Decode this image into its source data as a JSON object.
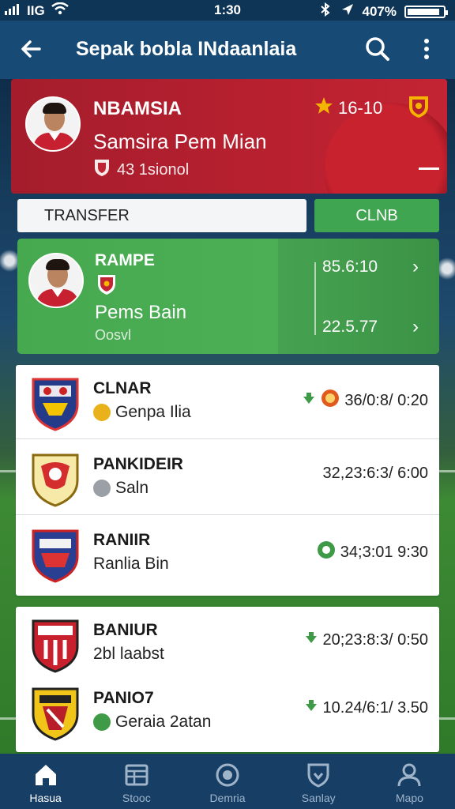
{
  "status": {
    "carrier": "IIG",
    "time": "1:30",
    "battery": "407%",
    "battery_level": 0.9
  },
  "appbar": {
    "title": "Sepak bobla INdaanlaia"
  },
  "hero": {
    "name": "NBAMSIA",
    "subtitle": "Samsira Pem Mian",
    "meta": "43 1sionol",
    "rating": "16-10",
    "colors": {
      "bg": "#b8202f",
      "accent": "#f5b400"
    }
  },
  "tabs": {
    "transfer": "TRANSFER",
    "club": "CLNB"
  },
  "featured": {
    "label": "RAMPE",
    "name": "Pems Bain",
    "position": "Oosvl",
    "value_top": "85.6:10",
    "value_bottom": "22.5.77"
  },
  "list": [
    {
      "club": "CLNAR",
      "player": "Genpa Ilia",
      "stat": "36/0:8/ 0:20",
      "icon": "arrow-down-icon",
      "badge": "orange-badge-icon"
    },
    {
      "club": "PANKIDEIR",
      "player": "Saln",
      "stat": "32,23:6:3/ 6:00",
      "icon": "",
      "badge": ""
    },
    {
      "club": "RANIIR",
      "player": "Ranlia Bin",
      "stat": "34;3:01 9:30",
      "icon": "green-circle-icon",
      "badge": ""
    },
    {
      "club": "BANIUR",
      "player": "2bl laabst",
      "stat": "20;23:8:3/ 0:50",
      "icon": "arrow-down-icon",
      "badge": ""
    },
    {
      "club": "PANIO7",
      "player": "Geraia 2atan",
      "stat": "10.24/6:1/ 3.50",
      "icon": "arrow-down-icon",
      "badge": ""
    }
  ],
  "nav": [
    {
      "label": "Hasua",
      "icon": "home-icon"
    },
    {
      "label": "Stooc",
      "icon": "table-icon"
    },
    {
      "label": "Demria",
      "icon": "record-icon"
    },
    {
      "label": "Sanlay",
      "icon": "shield-icon"
    },
    {
      "label": "Mapo",
      "icon": "person-icon"
    }
  ]
}
